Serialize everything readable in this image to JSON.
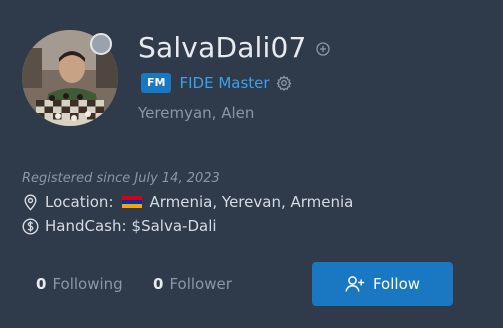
{
  "profile": {
    "username": "SalvaDali07",
    "title_badge": "FM",
    "title_name": "FIDE Master",
    "real_name": "Yeremyan, Alen",
    "registered": "Registered since July 14, 2023",
    "location_label": "Location:",
    "location_value": "Armenia, Yerevan, Armenia",
    "handcash_label": "HandCash:",
    "handcash_value": "$Salva-Dali",
    "status": "offline"
  },
  "stats": {
    "following_count": "0",
    "following_label": "Following",
    "followers_count": "0",
    "followers_label": "Follower"
  },
  "actions": {
    "follow_label": "Follow"
  },
  "colors": {
    "background": "#2f3a4b",
    "accent": "#1a78c2",
    "title_text": "#3ba2e8",
    "muted": "#8c96a4",
    "status_offline": "#9aa3ad"
  },
  "icons": {
    "add": "plus-circle-icon",
    "settings": "gear-icon",
    "location": "map-pin-icon",
    "handcash": "dollar-circle-icon",
    "follow": "user-plus-icon",
    "flag": "armenia-flag-icon"
  }
}
